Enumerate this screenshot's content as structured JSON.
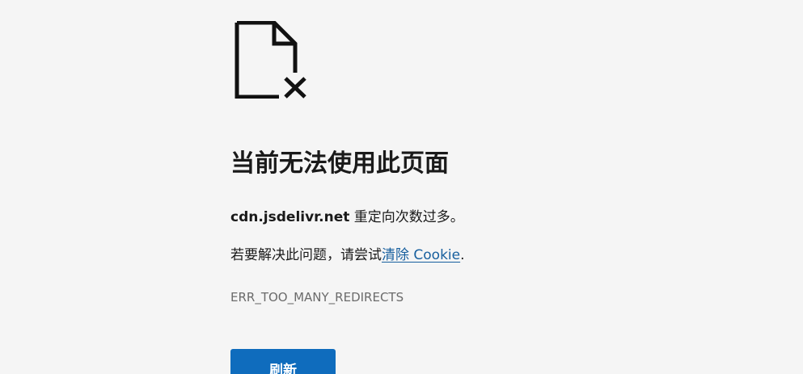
{
  "error_page": {
    "icon": "broken-document-icon",
    "title": "当前无法使用此页面",
    "host": "cdn.jsdelivr.net",
    "host_message": " 重定向次数过多。",
    "fix_prefix": "若要解决此问题，请尝试",
    "fix_link": "清除 Cookie",
    "fix_suffix": ".",
    "error_code": "ERR_TOO_MANY_REDIRECTS",
    "reload_label": "刷新"
  },
  "colors": {
    "background": "#f5f5f5",
    "link": "#175f9e",
    "button": "#0f6cbd",
    "error_code": "#6b6b6b"
  }
}
